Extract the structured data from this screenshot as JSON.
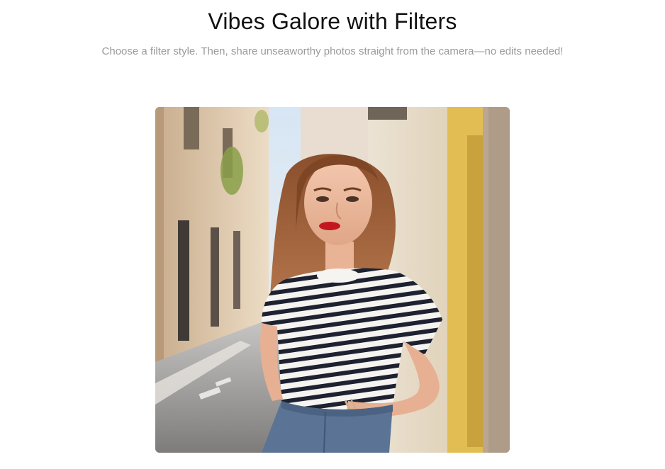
{
  "header": {
    "title": "Vibes Galore with Filters",
    "subtitle": "Choose a filter style. Then, share unseaworthy photos straight from the camera—no edits needed!"
  },
  "photo": {
    "subject": "portrait-photo"
  },
  "colors": {
    "title": "#111111",
    "subtitle": "#9a9a9a",
    "background": "#ffffff"
  }
}
